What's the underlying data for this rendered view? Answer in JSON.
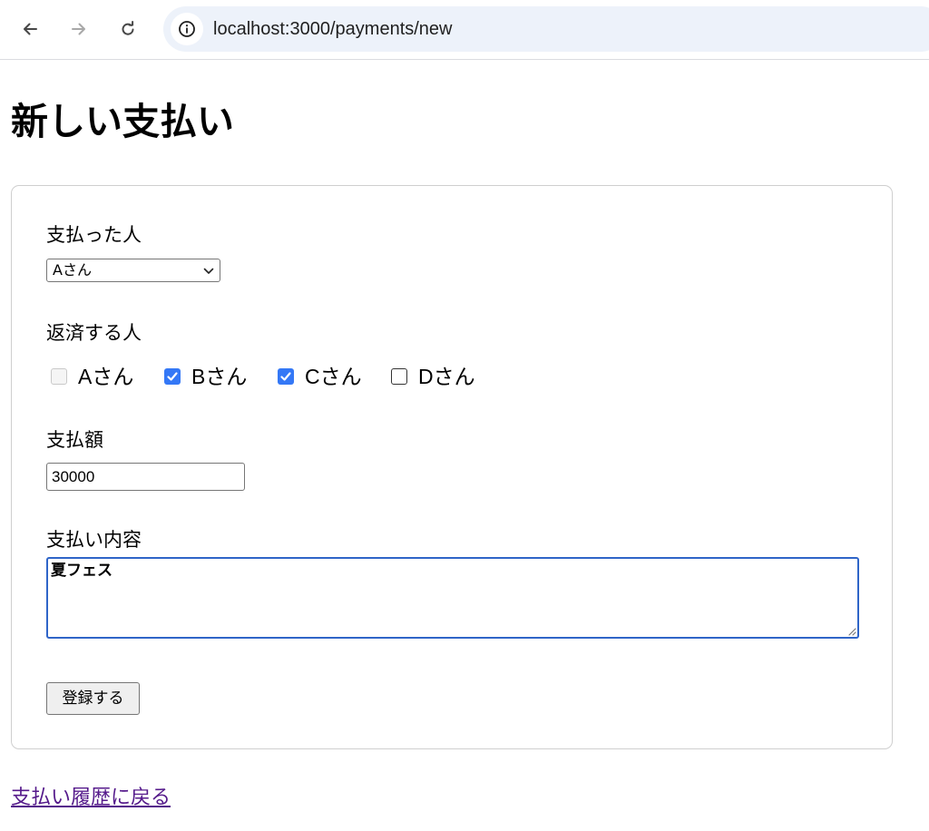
{
  "browser": {
    "url": "localhost:3000/payments/new",
    "icons": [
      "back-arrow-icon",
      "forward-arrow-icon",
      "reload-icon",
      "info-icon"
    ]
  },
  "page": {
    "title": "新しい支払い"
  },
  "form": {
    "payer": {
      "label": "支払った人",
      "selected": "Aさん"
    },
    "repayers": {
      "label": "返済する人",
      "options": [
        {
          "label": "Aさん",
          "checked": false,
          "disabled": true
        },
        {
          "label": "Bさん",
          "checked": true,
          "disabled": false
        },
        {
          "label": "Cさん",
          "checked": true,
          "disabled": false
        },
        {
          "label": "Dさん",
          "checked": false,
          "disabled": false
        }
      ]
    },
    "amount": {
      "label": "支払額",
      "value": "30000"
    },
    "description": {
      "label": "支払い内容",
      "value": "夏フェス"
    },
    "submit_label": "登録する"
  },
  "back_link": "支払い履歴に戻る",
  "colors": {
    "checkbox_checked": "#3478f6",
    "focus_border": "#2f65c8",
    "visited_link": "#551a8b",
    "omnibox_bg": "#edf2fa"
  }
}
